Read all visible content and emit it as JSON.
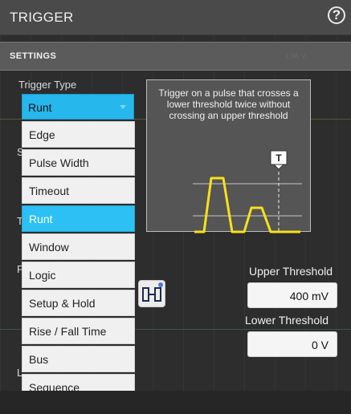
{
  "header": {
    "title": "TRIGGER",
    "help": "?"
  },
  "settings": {
    "label": "SETTINGS",
    "faint_value": "1.96 V"
  },
  "trigger_type": {
    "label": "Trigger Type",
    "selected": "Runt"
  },
  "menu": {
    "items": [
      "Edge",
      "Pulse Width",
      "Timeout",
      "Runt",
      "Window",
      "Logic",
      "Setup & Hold",
      "Rise / Fall Time",
      "Bus",
      "Sequence"
    ],
    "selected_index": 3
  },
  "description": {
    "text": "Trigger on a pulse that crosses a lower threshold twice without crossing an upper threshold",
    "marker": "T"
  },
  "upper_threshold": {
    "label": "Upper Threshold",
    "value": "400 mV"
  },
  "lower_threshold": {
    "label": "Lower Threshold",
    "value": "0 V"
  },
  "partial_labels": {
    "s": "S",
    "t": "T",
    "f": "F",
    "l": "L"
  },
  "colors": {
    "accent": "#2cc0f4",
    "waveform": "#f7e11b",
    "panel_header": "#4a4a4a"
  }
}
